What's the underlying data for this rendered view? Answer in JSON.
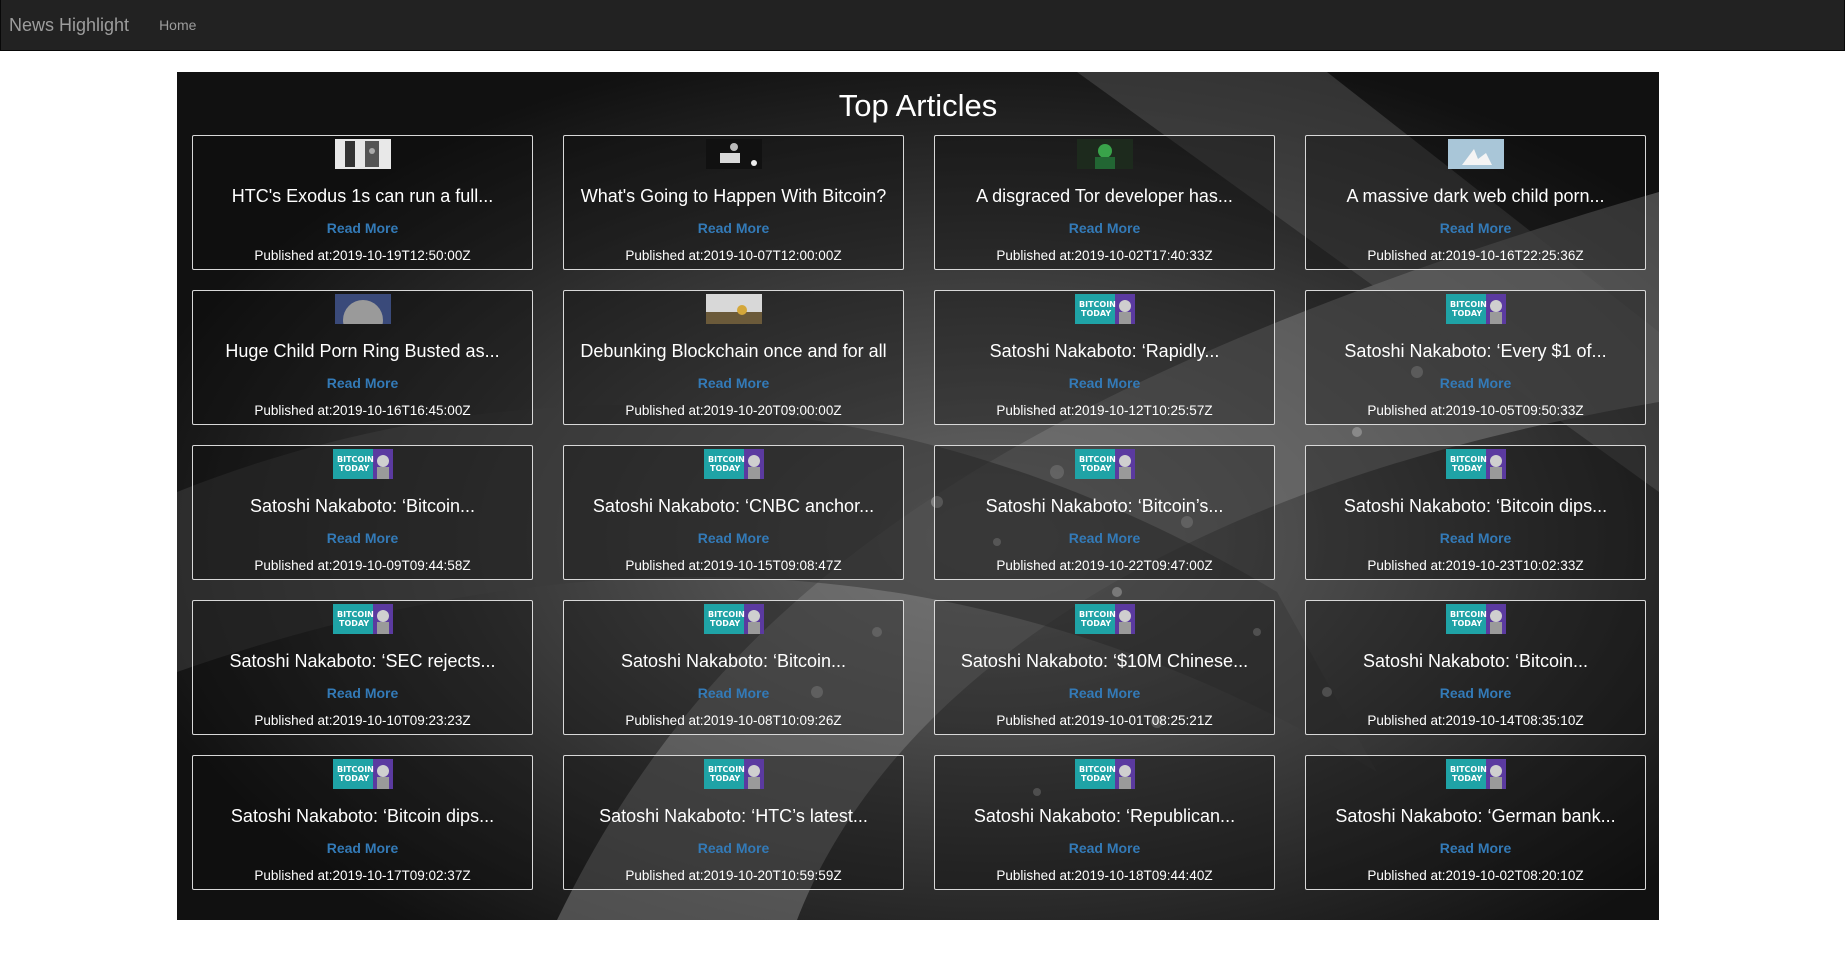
{
  "nav": {
    "brand": "News Highlight",
    "home": "Home"
  },
  "main": {
    "heading": "Top Articles",
    "read_more": "Read More",
    "published_prefix": "Published at:"
  },
  "articles": [
    {
      "title": "HTC's Exodus 1s can run a full...",
      "published": "2019-10-19T12:50:00Z",
      "thumb": "phone"
    },
    {
      "title": "What's Going to Happen With Bitcoin?",
      "published": "2019-10-07T12:00:00Z",
      "thumb": "hand"
    },
    {
      "title": "A disgraced Tor developer has...",
      "published": "2019-10-02T17:40:33Z",
      "thumb": "matrix"
    },
    {
      "title": "A massive dark web child porn...",
      "published": "2019-10-16T22:25:36Z",
      "thumb": "sky"
    },
    {
      "title": "Huge Child Porn Ring Busted as...",
      "published": "2019-10-16T16:45:00Z",
      "thumb": "coin"
    },
    {
      "title": "Debunking Blockchain once and for all",
      "published": "2019-10-20T09:00:00Z",
      "thumb": "gold"
    },
    {
      "title": "Satoshi Nakaboto: ‘Rapidly...",
      "published": "2019-10-12T10:25:57Z",
      "thumb": "btctoday"
    },
    {
      "title": "Satoshi Nakaboto: ‘Every $1 of...",
      "published": "2019-10-05T09:50:33Z",
      "thumb": "btctoday"
    },
    {
      "title": "Satoshi Nakaboto: ‘Bitcoin...",
      "published": "2019-10-09T09:44:58Z",
      "thumb": "btctoday"
    },
    {
      "title": "Satoshi Nakaboto: ‘CNBC anchor...",
      "published": "2019-10-15T09:08:47Z",
      "thumb": "btctoday"
    },
    {
      "title": "Satoshi Nakaboto: ‘Bitcoin’s...",
      "published": "2019-10-22T09:47:00Z",
      "thumb": "btctoday"
    },
    {
      "title": "Satoshi Nakaboto: ‘Bitcoin dips...",
      "published": "2019-10-23T10:02:33Z",
      "thumb": "btctoday"
    },
    {
      "title": "Satoshi Nakaboto: ‘SEC rejects...",
      "published": "2019-10-10T09:23:23Z",
      "thumb": "btctoday"
    },
    {
      "title": "Satoshi Nakaboto: ‘Bitcoin...",
      "published": "2019-10-08T10:09:26Z",
      "thumb": "btctoday"
    },
    {
      "title": "Satoshi Nakaboto: ‘$10M Chinese...",
      "published": "2019-10-01T08:25:21Z",
      "thumb": "btctoday"
    },
    {
      "title": "Satoshi Nakaboto: ‘Bitcoin...",
      "published": "2019-10-14T08:35:10Z",
      "thumb": "btctoday"
    },
    {
      "title": "Satoshi Nakaboto: ‘Bitcoin dips...",
      "published": "2019-10-17T09:02:37Z",
      "thumb": "btctoday"
    },
    {
      "title": "Satoshi Nakaboto: ‘HTC’s latest...",
      "published": "2019-10-20T10:59:59Z",
      "thumb": "btctoday"
    },
    {
      "title": "Satoshi Nakaboto: ‘Republican...",
      "published": "2019-10-18T09:44:40Z",
      "thumb": "btctoday"
    },
    {
      "title": "Satoshi Nakaboto: ‘German bank...",
      "published": "2019-10-02T08:20:10Z",
      "thumb": "btctoday"
    }
  ]
}
